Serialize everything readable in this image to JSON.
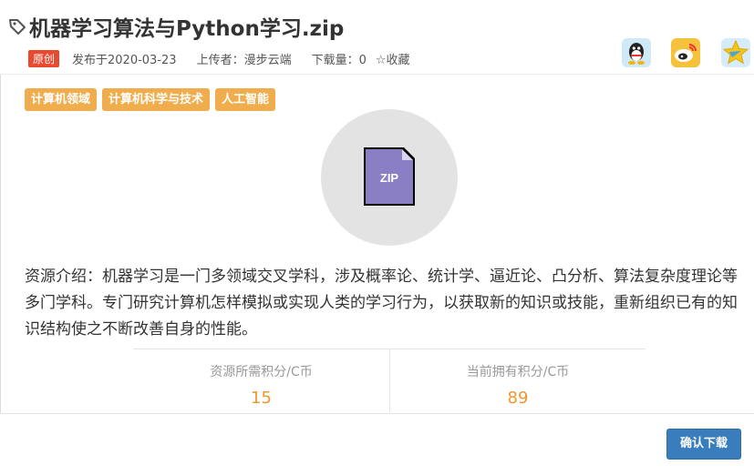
{
  "resource": {
    "title": "机器学习算法与Python学习.zip",
    "badge": "原创",
    "published": "发布于2020-03-23",
    "uploader": "上传者：漫步云端",
    "downloads": "下载量：0",
    "favorite": "☆收藏"
  },
  "share": [
    {
      "name": "qq-share-icon"
    },
    {
      "name": "weibo-share-icon"
    },
    {
      "name": "qzone-share-icon"
    }
  ],
  "tags": [
    "计算机领域",
    "计算机科学与技术",
    "人工智能"
  ],
  "file": {
    "type_label": "ZIP",
    "color": "#8a7fc4"
  },
  "description": "资源介绍：机器学习是一门多领域交叉学科，涉及概率论、统计学、逼近论、凸分析、算法复杂度理论等多门学科。专门研究计算机怎样模拟或实现人类的学习行为，以获取新的知识或技能，重新组织已有的知识结构使之不断改善自身的性能。",
  "stats": {
    "required_label": "资源所需积分/C币",
    "required_value": "15",
    "owned_label": "当前拥有积分/C币",
    "owned_value": "89"
  },
  "footer": {
    "confirm_label": "确认下载"
  },
  "colors": {
    "accent": "#f0ad4e",
    "badge": "#e9492f",
    "button": "#3a7dbd",
    "value": "#f0962b"
  }
}
